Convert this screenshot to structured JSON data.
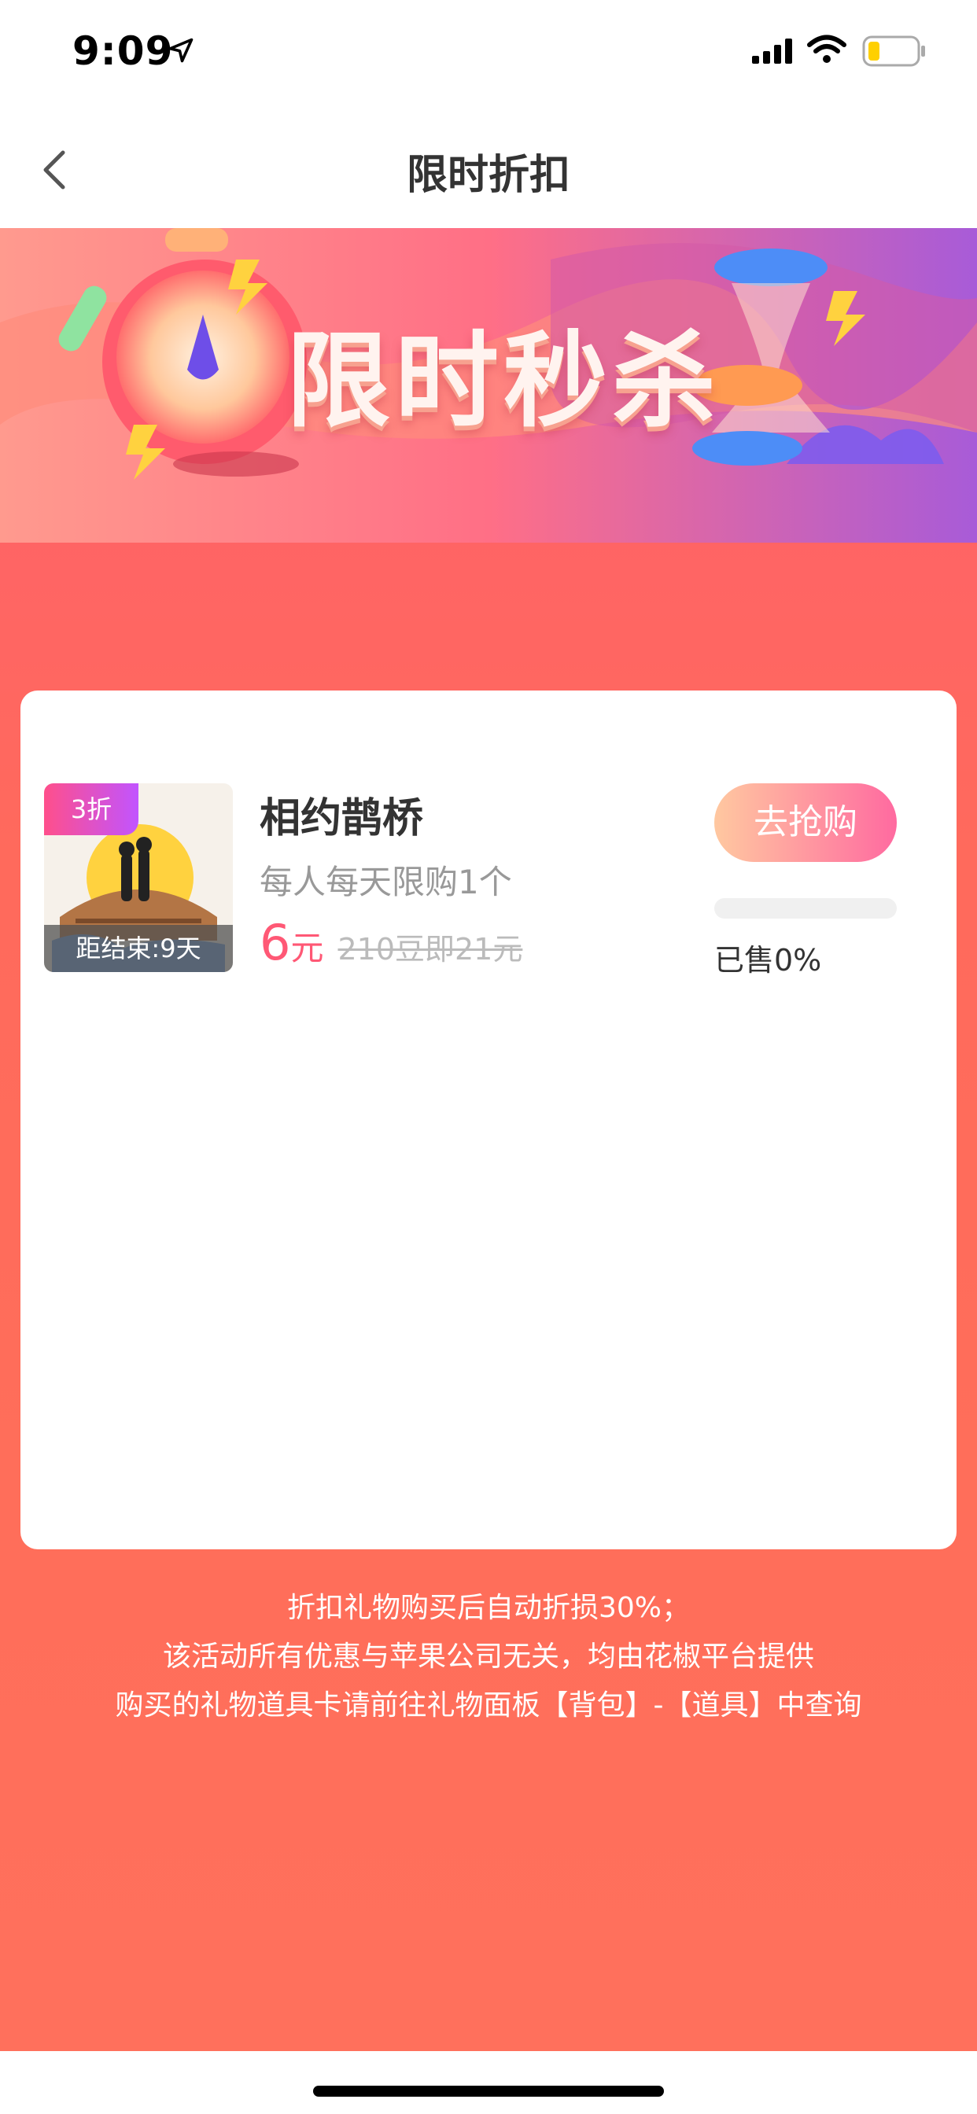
{
  "status_bar": {
    "time": "9:09"
  },
  "nav": {
    "title": "限时折扣"
  },
  "banner": {
    "title": "限时秒杀"
  },
  "product": {
    "discount_badge": "3折",
    "countdown": "距结束:9天",
    "name": "相约鹊桥",
    "limit": "每人每天限购1个",
    "price": "6",
    "price_unit": "元",
    "original_price": "210豆即21元",
    "buy_label": "去抢购",
    "sold_label": "已售0%",
    "sold_percent": 0
  },
  "notes": [
    "折扣礼物购买后自动折损30%；",
    "该活动所有优惠与苹果公司无关，均由花椒平台提供",
    "购买的礼物道具卡请前往礼物面板【背包】-【道具】中查询"
  ],
  "colors": {
    "accent": "#ff5875",
    "background": "#ff6a5c"
  }
}
